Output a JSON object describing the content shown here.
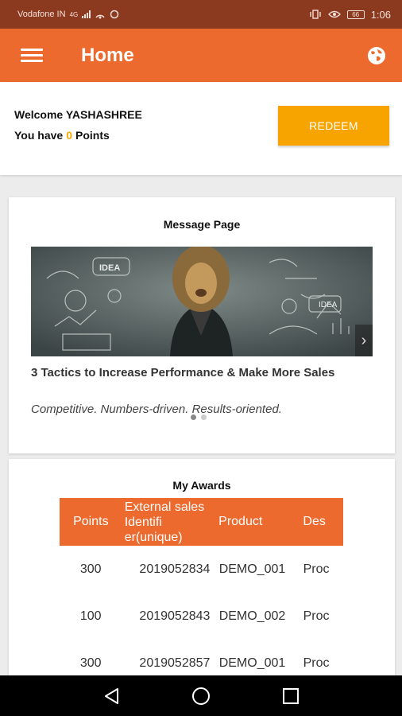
{
  "status_bar": {
    "carrier": "Vodafone IN",
    "network": "4G",
    "battery": "66",
    "time": "1:06"
  },
  "app_bar": {
    "title": "Home",
    "menu_icon": "hamburger-menu-icon",
    "globe_icon": "globe-icon"
  },
  "welcome": {
    "greeting": "Welcome YASHASHREE",
    "points_prefix": "You have",
    "points_value": "0",
    "points_suffix": "Points",
    "redeem_label": "REDEEM"
  },
  "messages": {
    "title": "Message Page",
    "article_title": "3 Tactics to Increase Performance & Make More Sales",
    "article_subtitle": "Competitive. Numbers-driven. Results-oriented.",
    "banner_text": "IDEA",
    "active_slide": 0,
    "slide_count": 2
  },
  "awards": {
    "title": "My Awards",
    "columns": [
      "Points",
      "External sales Identifi er(unique)",
      "Product",
      "Des"
    ],
    "rows": [
      {
        "points": "300",
        "id": "2019052834",
        "product": "DEMO_001",
        "desc": "Proc"
      },
      {
        "points": "100",
        "id": "2019052843",
        "product": "DEMO_002",
        "desc": "Proc"
      },
      {
        "points": "300",
        "id": "2019052857",
        "product": "DEMO_001",
        "desc": "Proc"
      }
    ]
  },
  "colors": {
    "primary": "#ec6a2e",
    "status_bar": "#8b3a20",
    "accent": "#f7a400"
  },
  "nav": {
    "back_icon": "back-triangle-icon",
    "home_icon": "home-circle-icon",
    "recents_icon": "recents-square-icon"
  }
}
